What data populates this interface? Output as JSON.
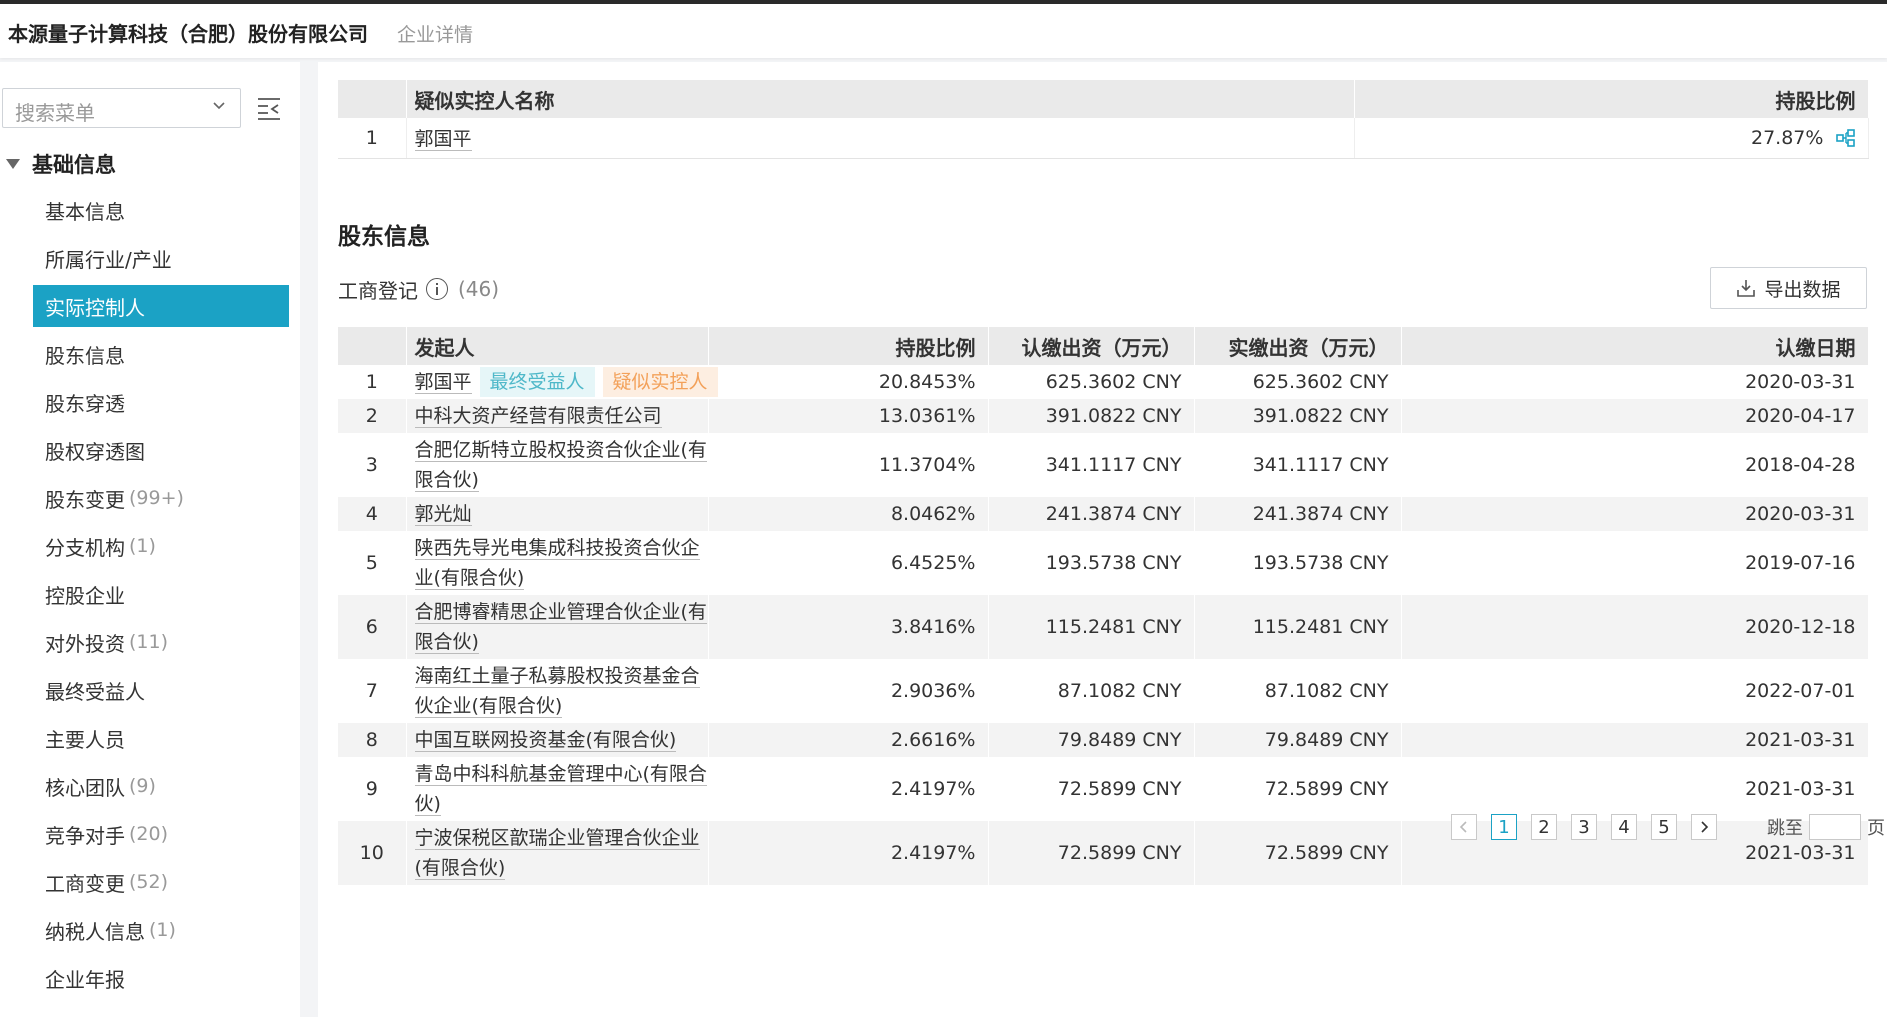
{
  "header": {
    "company": "本源量子计算科技（合肥）股份有限公司",
    "subtitle": "企业详情"
  },
  "sidebar": {
    "search_placeholder": "搜索菜单",
    "group": "基础信息",
    "items": [
      {
        "label": "基本信息",
        "count": ""
      },
      {
        "label": "所属行业/产业",
        "count": ""
      },
      {
        "label": "实际控制人",
        "count": "",
        "active": true
      },
      {
        "label": "股东信息",
        "count": ""
      },
      {
        "label": "股东穿透",
        "count": ""
      },
      {
        "label": "股权穿透图",
        "count": ""
      },
      {
        "label": "股东变更",
        "count": "(99+)"
      },
      {
        "label": "分支机构",
        "count": "(1)"
      },
      {
        "label": "控股企业",
        "count": ""
      },
      {
        "label": "对外投资",
        "count": "(11)"
      },
      {
        "label": "最终受益人",
        "count": ""
      },
      {
        "label": "主要人员",
        "count": ""
      },
      {
        "label": "核心团队",
        "count": "(9)"
      },
      {
        "label": "竞争对手",
        "count": "(20)"
      },
      {
        "label": "工商变更",
        "count": "(52)"
      },
      {
        "label": "纳税人信息",
        "count": "(1)"
      },
      {
        "label": "企业年报",
        "count": ""
      }
    ]
  },
  "controller_table": {
    "headers": [
      "",
      "疑似实控人名称",
      "持股比例"
    ],
    "rows": [
      {
        "no": "1",
        "name": "郭国平",
        "ratio": "27.87%"
      }
    ]
  },
  "shareholders": {
    "title": "股东信息",
    "registry_label": "工商登记",
    "registry_count": "(46)",
    "export_label": "导出数据",
    "headers": [
      "",
      "发起人",
      "持股比例",
      "认缴出资（万元）",
      "实缴出资（万元）",
      "认缴日期"
    ],
    "rows": [
      {
        "no": "1",
        "name": "郭国平",
        "tags": [
          "最终受益人",
          "疑似实控人"
        ],
        "ratio": "20.8453%",
        "subscribed": "625.3602 CNY",
        "paid": "625.3602 CNY",
        "date": "2020-03-31"
      },
      {
        "no": "2",
        "name": "中科大资产经营有限责任公司",
        "tags": [],
        "ratio": "13.0361%",
        "subscribed": "391.0822 CNY",
        "paid": "391.0822 CNY",
        "date": "2020-04-17"
      },
      {
        "no": "3",
        "name": "合肥亿斯特立股权投资合伙企业(有限合伙)",
        "tags": [],
        "ratio": "11.3704%",
        "subscribed": "341.1117 CNY",
        "paid": "341.1117 CNY",
        "date": "2018-04-28"
      },
      {
        "no": "4",
        "name": "郭光灿",
        "tags": [],
        "ratio": "8.0462%",
        "subscribed": "241.3874 CNY",
        "paid": "241.3874 CNY",
        "date": "2020-03-31"
      },
      {
        "no": "5",
        "name": "陕西先导光电集成科技投资合伙企业(有限合伙)",
        "tags": [],
        "ratio": "6.4525%",
        "subscribed": "193.5738 CNY",
        "paid": "193.5738 CNY",
        "date": "2019-07-16"
      },
      {
        "no": "6",
        "name": "合肥博睿精思企业管理合伙企业(有限合伙)",
        "tags": [],
        "ratio": "3.8416%",
        "subscribed": "115.2481 CNY",
        "paid": "115.2481 CNY",
        "date": "2020-12-18"
      },
      {
        "no": "7",
        "name": "海南红土量子私募股权投资基金合伙企业(有限合伙)",
        "tags": [],
        "ratio": "2.9036%",
        "subscribed": "87.1082 CNY",
        "paid": "87.1082 CNY",
        "date": "2022-07-01"
      },
      {
        "no": "8",
        "name": "中国互联网投资基金(有限合伙)",
        "tags": [],
        "ratio": "2.6616%",
        "subscribed": "79.8489 CNY",
        "paid": "79.8489 CNY",
        "date": "2021-03-31"
      },
      {
        "no": "9",
        "name": "青岛中科科航基金管理中心(有限合伙)",
        "tags": [],
        "ratio": "2.4197%",
        "subscribed": "72.5899 CNY",
        "paid": "72.5899 CNY",
        "date": "2021-03-31"
      },
      {
        "no": "10",
        "name": "宁波保税区歆瑞企业管理合伙企业(有限合伙)",
        "tags": [],
        "ratio": "2.4197%",
        "subscribed": "72.5899 CNY",
        "paid": "72.5899 CNY",
        "date": "2021-03-31"
      }
    ]
  },
  "pagination": {
    "pages": [
      "1",
      "2",
      "3",
      "4",
      "5"
    ],
    "current": "1",
    "jump_label": "跳至",
    "page_label": "页"
  },
  "colors": {
    "accent": "#1ba2c5",
    "tag_benef": "#4fb8c9",
    "tag_ctrl": "#f3a15a"
  }
}
